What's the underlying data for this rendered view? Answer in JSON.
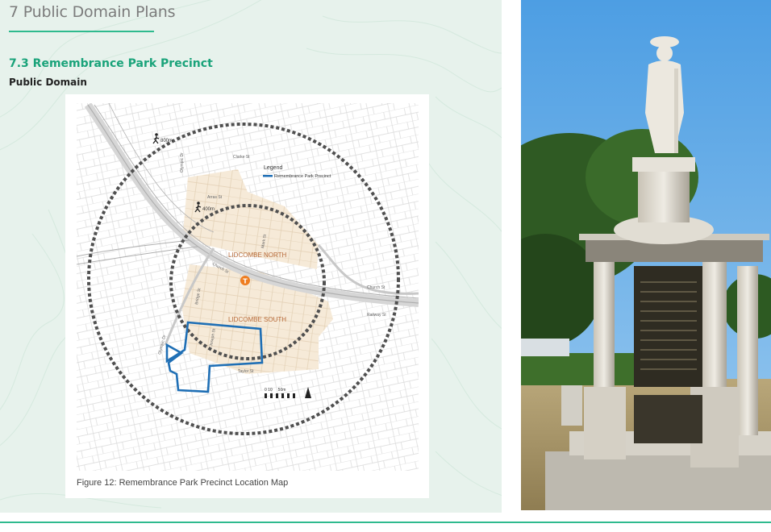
{
  "page": {
    "chapter_title": "7 Public Domain Plans",
    "section_title": "7.3 Remembrance Park Precinct",
    "section_subtitle": "Public Domain",
    "accent_color": "#2fba8e",
    "heading_color": "#1aa37a",
    "panel_color": "#e7f2ec"
  },
  "figure": {
    "caption": "Figure 12: Remembrance Park Precinct Location Map",
    "legend": {
      "title": "Legend",
      "item": "Remembrance Park Precinct",
      "item_color": "#1f6fb5"
    },
    "radius_outer_label": "800m",
    "radius_inner_label": "400m",
    "areas": {
      "north": "LIDCOMBE NORTH",
      "south": "LIDCOMBE SOUTH"
    },
    "station_icon": "train-station-icon",
    "streets": {
      "church_st_1": "Church St",
      "church_st_2": "Church St",
      "railway_st": "Railway St",
      "olympic_dr_1": "Olympic Dr",
      "olympic_dr_2": "Olympic Dr",
      "arras_st": "Arras St",
      "clarke_st": "Clarke St",
      "mark_st": "Mark St",
      "joseph_st": "Joseph St",
      "bridge_st": "Bridge St",
      "taylor_st": "Taylor St"
    },
    "scale": {
      "label": "0 10     50m"
    },
    "north_arrow_icon": "north-arrow-icon"
  },
  "photo": {
    "subject": "war-memorial-statue-photo",
    "header_text": "FOR GOD KING AND COUNTRY",
    "panel_text": "IN HONOUR OF THE FALLEN",
    "erected_lines": [
      "ERECTED",
      "BY THE CITIZENS OF",
      "LIDCOMBE",
      "IN COMMEMORATION OF THOSE OF",
      "THIS DISTRICT WHO FOUGHT IN THE GREAT WAR",
      "1914 - 1918"
    ]
  }
}
